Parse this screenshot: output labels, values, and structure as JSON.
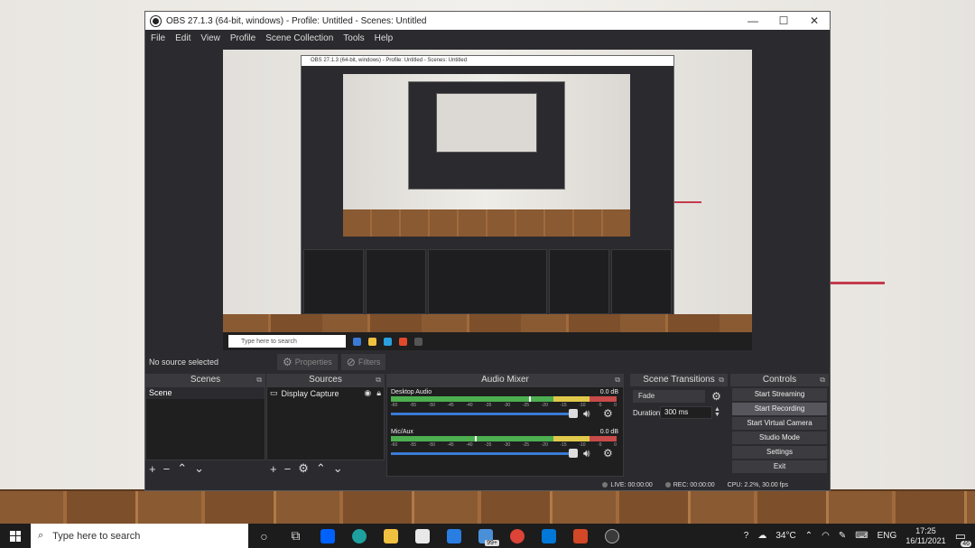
{
  "window": {
    "title": "OBS 27.1.3 (64-bit, windows) - Profile: Untitled - Scenes: Untitled",
    "minimize": "—",
    "maximize": "☐",
    "close": "✕"
  },
  "menu": [
    "File",
    "Edit",
    "View",
    "Profile",
    "Scene Collection",
    "Tools",
    "Help"
  ],
  "source_bar": {
    "no_source": "No source selected",
    "properties": "Properties",
    "filters": "Filters"
  },
  "scenes": {
    "title": "Scenes",
    "items": [
      "Scene"
    ]
  },
  "sources": {
    "title": "Sources",
    "items": [
      "Display Capture"
    ]
  },
  "mixer": {
    "title": "Audio Mixer",
    "channels": [
      {
        "name": "Desktop Audio",
        "db": "0.0 dB",
        "level": 0.62
      },
      {
        "name": "Mic/Aux",
        "db": "0.0 dB",
        "level": 0.38
      }
    ],
    "ticks": [
      "-60",
      "-55",
      "-50",
      "-45",
      "-40",
      "-35",
      "-30",
      "-25",
      "-20",
      "-15",
      "-10",
      "-5",
      "0"
    ]
  },
  "transitions": {
    "title": "Scene Transitions",
    "selected": "Fade",
    "duration_label": "Duration",
    "duration_value": "300 ms"
  },
  "controls": {
    "title": "Controls",
    "buttons": [
      "Start Streaming",
      "Start Recording",
      "Start Virtual Camera",
      "Studio Mode",
      "Settings",
      "Exit"
    ]
  },
  "status": {
    "live": "LIVE: 00:00:00",
    "rec": "REC: 00:00:00",
    "cpu": "CPU: 2.2%, 30.00 fps"
  },
  "preview": {
    "inner_title": "OBS 27.1.3 (64-bit, windows) - Profile: Untitled - Scenes: Untitled",
    "search": "Type here to search"
  },
  "taskbar": {
    "search_placeholder": "Type here to search",
    "badge": "99+",
    "temperature": "34°C",
    "language": "ENG",
    "time": "17:25",
    "date": "16/11/2021",
    "notifications": "46"
  },
  "colors": {
    "accent_red": "#c33b4d",
    "obs_bg": "#2b2b2f",
    "slider_blue": "#3a7bd5"
  }
}
